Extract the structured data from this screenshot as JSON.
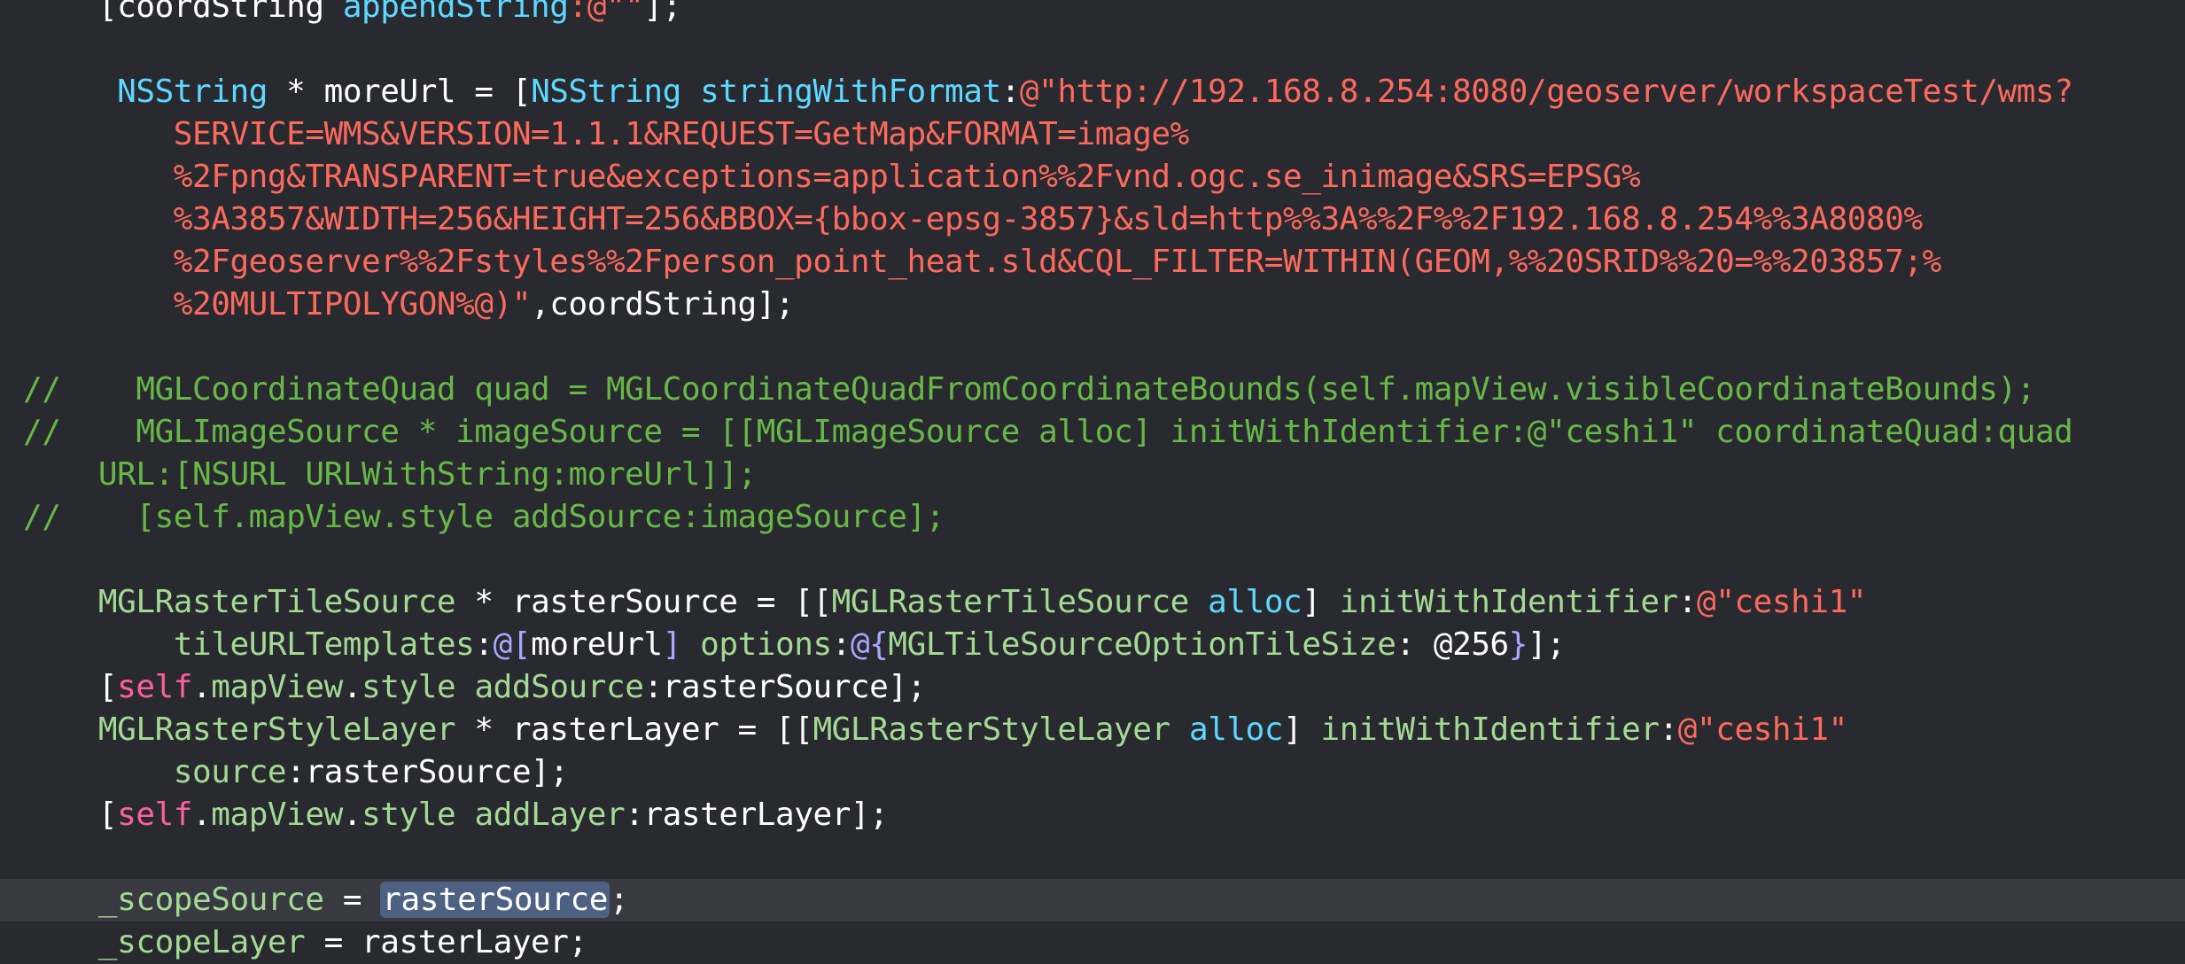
{
  "editor": {
    "theme_colors": {
      "background": "#292a30",
      "current_line_highlight": "#393a41",
      "selection": "#4d6182",
      "plain": "#ffffff",
      "string": "#fc6a5d",
      "class": "#5dd8ff",
      "project_symbol": "#a3d993",
      "keyword": "#fc5fa3",
      "comment": "#67b847",
      "number": "#d0bf69",
      "punct_brace": "#a8a8ff"
    },
    "current_line_index": 21,
    "selected_text": "rasterSource",
    "lines": [
      [
        {
          "t": "    [coordString ",
          "c": "#ffffff"
        },
        {
          "t": "appendString",
          "c": "#5dd8ff"
        },
        {
          "t": ":@\"\"",
          "c": "#fc6a5d"
        },
        {
          "t": "];",
          "c": "#ffffff"
        }
      ],
      [],
      [
        {
          "t": "     ",
          "c": "#ffffff"
        },
        {
          "t": "NSString",
          "c": "#5dd8ff"
        },
        {
          "t": " * moreUrl = [",
          "c": "#ffffff"
        },
        {
          "t": "NSString",
          "c": "#5dd8ff"
        },
        {
          "t": " ",
          "c": "#ffffff"
        },
        {
          "t": "stringWithFormat",
          "c": "#5dd8ff"
        },
        {
          "t": ":",
          "c": "#ffffff"
        },
        {
          "t": "@\"http://192.168.8.254:8080/geoserver/workspaceTest/wms?",
          "c": "#fc6a5d"
        }
      ],
      [
        {
          "t": "        SERVICE=WMS&VERSION=1.1.1&REQUEST=GetMap&FORMAT=image%",
          "c": "#fc6a5d"
        }
      ],
      [
        {
          "t": "        %2Fpng&TRANSPARENT=true&exceptions=application%%2Fvnd.ogc.se_inimage&SRS=EPSG%",
          "c": "#fc6a5d"
        }
      ],
      [
        {
          "t": "        %3A3857&WIDTH=256&HEIGHT=256&BBOX={bbox-epsg-3857}&sld=http%%3A%%2F%%2F192.168.8.254%%3A8080%",
          "c": "#fc6a5d"
        }
      ],
      [
        {
          "t": "        %2Fgeoserver%%2Fstyles%%2Fperson_point_heat.sld&CQL_FILTER=WITHIN(GEOM,%%20SRID%%20=%%203857;%",
          "c": "#fc6a5d"
        }
      ],
      [
        {
          "t": "        %20MULTIPOLYGON%@)\"",
          "c": "#fc6a5d"
        },
        {
          "t": ",coordString];",
          "c": "#ffffff"
        }
      ],
      [],
      [
        {
          "t": "//    MGLCoordinateQuad quad = MGLCoordinateQuadFromCoordinateBounds(self.mapView.visibleCoordinateBounds);",
          "c": "#67b847"
        }
      ],
      [
        {
          "t": "//    MGLImageSource * imageSource = [[MGLImageSource alloc] initWithIdentifier:@\"ceshi1\" coordinateQuad:quad",
          "c": "#67b847"
        }
      ],
      [
        {
          "t": "    URL:[NSURL URLWithString:moreUrl]];",
          "c": "#67b847"
        }
      ],
      [
        {
          "t": "//    [self.mapView.style addSource:imageSource];",
          "c": "#67b847"
        }
      ],
      [],
      [
        {
          "t": "    ",
          "c": "#ffffff"
        },
        {
          "t": "MGLRasterTileSource",
          "c": "#a3d993"
        },
        {
          "t": " * rasterSource = [[",
          "c": "#ffffff"
        },
        {
          "t": "MGLRasterTileSource",
          "c": "#a3d993"
        },
        {
          "t": " ",
          "c": "#ffffff"
        },
        {
          "t": "alloc",
          "c": "#5dd8ff"
        },
        {
          "t": "] ",
          "c": "#ffffff"
        },
        {
          "t": "initWithIdentifier",
          "c": "#a3d993"
        },
        {
          "t": ":",
          "c": "#ffffff"
        },
        {
          "t": "@\"ceshi1\"",
          "c": "#fc6a5d"
        }
      ],
      [
        {
          "t": "        ",
          "c": "#ffffff"
        },
        {
          "t": "tileURLTemplates",
          "c": "#a3d993"
        },
        {
          "t": ":",
          "c": "#ffffff"
        },
        {
          "t": "@[",
          "c": "#a8a8ff"
        },
        {
          "t": "moreUrl",
          "c": "#ffffff"
        },
        {
          "t": "]",
          "c": "#a8a8ff"
        },
        {
          "t": " ",
          "c": "#ffffff"
        },
        {
          "t": "options",
          "c": "#a3d993"
        },
        {
          "t": ":",
          "c": "#ffffff"
        },
        {
          "t": "@{",
          "c": "#a8a8ff"
        },
        {
          "t": "MGLTileSourceOptionTileSize",
          "c": "#a3d993"
        },
        {
          "t": ": @256",
          "c": "#ffffff"
        },
        {
          "t": "}",
          "c": "#a8a8ff"
        },
        {
          "t": "];",
          "c": "#ffffff"
        }
      ],
      [
        {
          "t": "    [",
          "c": "#ffffff"
        },
        {
          "t": "self",
          "c": "#fc5fa3"
        },
        {
          "t": ".",
          "c": "#ffffff"
        },
        {
          "t": "mapView",
          "c": "#a3d993"
        },
        {
          "t": ".",
          "c": "#ffffff"
        },
        {
          "t": "style",
          "c": "#a3d993"
        },
        {
          "t": " ",
          "c": "#ffffff"
        },
        {
          "t": "addSource",
          "c": "#a3d993"
        },
        {
          "t": ":rasterSource];",
          "c": "#ffffff"
        }
      ],
      [
        {
          "t": "    ",
          "c": "#ffffff"
        },
        {
          "t": "MGLRasterStyleLayer",
          "c": "#a3d993"
        },
        {
          "t": " * rasterLayer = [[",
          "c": "#ffffff"
        },
        {
          "t": "MGLRasterStyleLayer",
          "c": "#a3d993"
        },
        {
          "t": " ",
          "c": "#ffffff"
        },
        {
          "t": "alloc",
          "c": "#5dd8ff"
        },
        {
          "t": "] ",
          "c": "#ffffff"
        },
        {
          "t": "initWithIdentifier",
          "c": "#a3d993"
        },
        {
          "t": ":",
          "c": "#ffffff"
        },
        {
          "t": "@\"ceshi1\"",
          "c": "#fc6a5d"
        }
      ],
      [
        {
          "t": "        ",
          "c": "#ffffff"
        },
        {
          "t": "source",
          "c": "#a3d993"
        },
        {
          "t": ":rasterSource];",
          "c": "#ffffff"
        }
      ],
      [
        {
          "t": "    [",
          "c": "#ffffff"
        },
        {
          "t": "self",
          "c": "#fc5fa3"
        },
        {
          "t": ".",
          "c": "#ffffff"
        },
        {
          "t": "mapView",
          "c": "#a3d993"
        },
        {
          "t": ".",
          "c": "#ffffff"
        },
        {
          "t": "style",
          "c": "#a3d993"
        },
        {
          "t": " ",
          "c": "#ffffff"
        },
        {
          "t": "addLayer",
          "c": "#a3d993"
        },
        {
          "t": ":rasterLayer];",
          "c": "#ffffff"
        }
      ],
      [],
      [
        {
          "t": "    ",
          "c": "#ffffff"
        },
        {
          "t": "_scopeSource",
          "c": "#a3d993"
        },
        {
          "t": " = ",
          "c": "#ffffff"
        },
        {
          "t": "rasterSource",
          "c": "#ffffff",
          "sel": true
        },
        {
          "t": ";",
          "c": "#ffffff"
        }
      ],
      [
        {
          "t": "    ",
          "c": "#ffffff"
        },
        {
          "t": "_scopeLayer",
          "c": "#a3d993"
        },
        {
          "t": " = rasterLayer;",
          "c": "#ffffff"
        }
      ]
    ]
  }
}
